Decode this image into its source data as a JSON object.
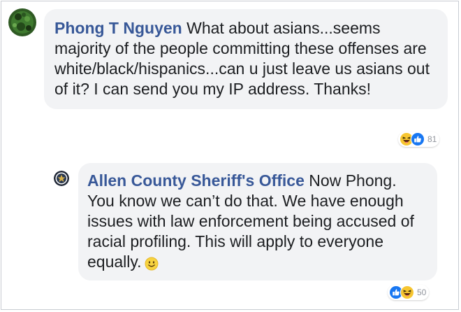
{
  "comments": [
    {
      "author": "Phong T Nguyen",
      "text": "What about asians...seems majority of the people committing these offenses are white/black/hispanics...can u just leave us asians out of it? I can send you my IP address. Thanks!",
      "reaction_icons": [
        "haha-icon",
        "like-icon"
      ],
      "reaction_count": "81"
    },
    {
      "author": "Allen County Sheriff's Office",
      "text": "Now Phong. You know we can’t do that. We have enough issues with law enforcement being accused of racial profiling. This will apply to everyone equally.",
      "emoji": "smile-emoji",
      "reaction_icons": [
        "like-icon",
        "haha-icon"
      ],
      "reaction_count": "50"
    }
  ],
  "colors": {
    "author_name": "#385898",
    "bubble_background": "#f2f3f5",
    "text": "#1c1e21",
    "like_blue": "#1877f2",
    "haha_yellow": "#f7c631",
    "count_gray": "#90949c"
  }
}
